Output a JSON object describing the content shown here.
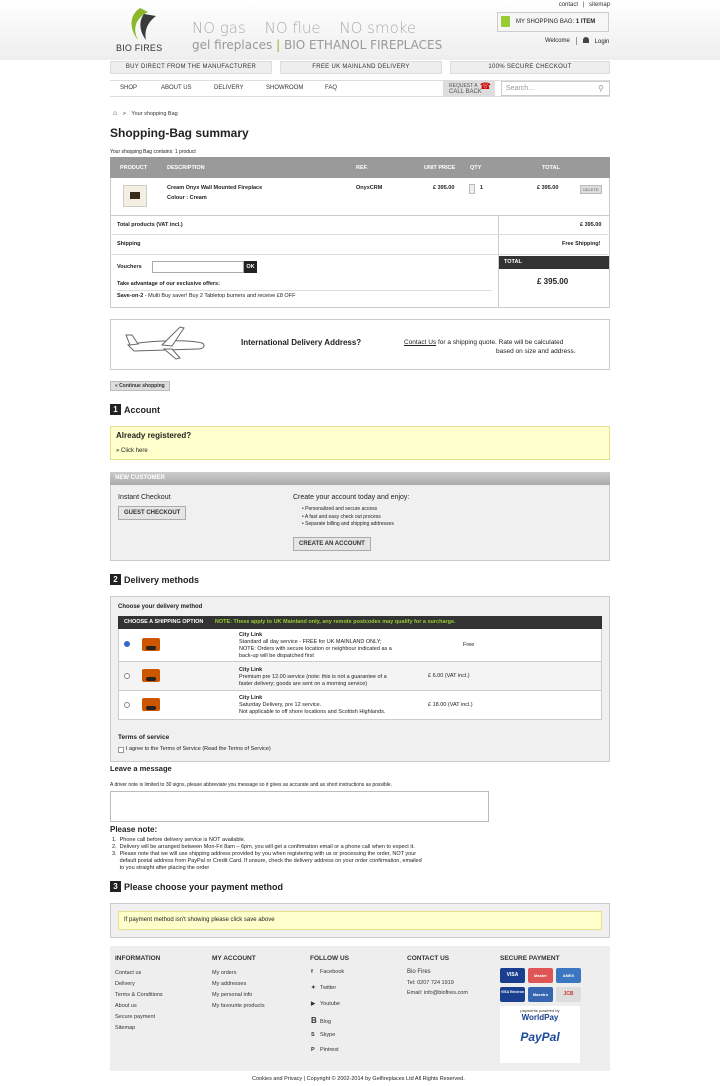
{
  "top_links": {
    "contact": "contact",
    "sep": "|",
    "sitemap": "sitemap"
  },
  "brand": {
    "logo_text": "BIO FIRES",
    "no_gas": "NO gas",
    "no_flue": "NO flue",
    "no_smoke": "NO smoke",
    "line2a": "gel fireplaces",
    "line2b": "BIO ETHANOL FIREPLACES"
  },
  "bag": {
    "label": "MY SHOPPING BAG:",
    "count": "1 ITEM"
  },
  "user": {
    "welcome": "Welcome",
    "login": "Login"
  },
  "promo_bars": [
    "BUY DIRECT FROM THE MANUFACTURER",
    "FREE UK MAINLAND DELIVERY",
    "100% SECURE CHECKOUT"
  ],
  "nav": [
    "SHOP",
    "ABOUT US",
    "DELIVERY",
    "SHOWROOM",
    "FAQ"
  ],
  "callback": {
    "l1": "REQUEST A",
    "l2": "CALL BACK"
  },
  "search": {
    "placeholder": "Search..."
  },
  "breadcrumb": {
    "sep": ">",
    "current": "Your shopping Bag"
  },
  "page_title": "Shopping-Bag summary",
  "contains": "Your shopping Bag contains: 1 product",
  "cart": {
    "headers": [
      "PRODUCT",
      "DESCRIPTION",
      "REF.",
      "UNIT PRICE",
      "QTY",
      "TOTAL"
    ],
    "item": {
      "name": "Cream Onyx Wall Mounted Fireplace",
      "colour": "Colour : Cream",
      "ref": "OnyxCRM",
      "unit": "£ 395.00",
      "qty": "1",
      "total": "£ 395.00",
      "delete": "DELETE"
    },
    "total_products_label": "Total products (VAT incl.)",
    "total_products": "£ 395.00",
    "shipping_label": "Shipping",
    "shipping": "Free Shipping!",
    "vouchers_label": "Vouchers",
    "ok": "OK",
    "offers_label": "Take advantage of our exclusive offers:",
    "offer_name": "Save-on-2",
    "offer_text": " - Multi Buy saver! Buy 2 Tabletop burners and receive £8 OFF",
    "total_label": "TOTAL",
    "total": "£ 395.00"
  },
  "intl": {
    "title": "International Delivery Address?",
    "link": "Contact Us",
    "text": " for a shipping quote. Rate will be calculated",
    "text2": "based on size and address."
  },
  "continue": "« Continue shopping",
  "account": {
    "num": "1",
    "title": "Account",
    "already": "Already registered?",
    "click": "» Click here",
    "new_customer": "NEW CUSTOMER",
    "instant": "Instant Checkout",
    "guest": "GUEST CHECKOUT",
    "create_text": "Create your account today and enjoy:",
    "benefits": [
      "Personalized and secure access",
      "A fast and easy check out process",
      "Separate billing and shipping addresses"
    ],
    "create_btn": "CREATE AN ACCOUNT"
  },
  "delivery": {
    "num": "2",
    "title": "Delivery methods",
    "choose": "Choose your delivery method",
    "hdr_label": "CHOOSE A SHIPPING OPTION",
    "hdr_note": "NOTE: These apply to UK Mainland only, any remote postcodes may qualify for a surcharge.",
    "options": [
      {
        "name": "City Link",
        "l1": "Standard all day service - FREE for UK MAINLAND ONLY;",
        "l2": "NOTE: Orders with secure location or neighbour indicated as a",
        "l3": "back-up will be dispatched first",
        "price": "Free"
      },
      {
        "name": "City Link",
        "l1": "Premium pre 12.00 service (note: this is not a guarantee of a",
        "l2": "faster delivery; goods are sent on a morning service)",
        "l3": "",
        "price": "£ 6.00 (VAT incl.)"
      },
      {
        "name": "City Link",
        "l1": "Saturday Delivery, pre 12 service.",
        "l2": "Not applicable to off shore locations and Scottish Highlands.",
        "l3": "",
        "price": "£ 18.00 (VAT incl.)"
      }
    ],
    "terms_title": "Terms of service",
    "terms_text": "I agree to the Terms of Service (Read the Terms of Service)"
  },
  "message": {
    "title": "Leave a message",
    "hint": "A driver note is limited to 30 signs, please abbreviate you message so it gives as accurate and as short instructions as possible."
  },
  "note": {
    "title": "Please note:",
    "items": [
      "1.  Phone call before delivery service is NOT available.",
      "2.  Delivery will be arranged between Mon-Fri 8am – 6pm, you will get a confirmation email or a phone call when to expect it.",
      "3.  Please note that we will use shipping address provided by you when registering with us or processing the order, NOT your",
      "     default postal address from PayPal or Credit Card. If unsure, check the delivery address on your order confirmation, emailed",
      "     to you straight after placing the order"
    ]
  },
  "payment": {
    "num": "3",
    "title": "Please choose your payment method",
    "warn": "If payment method isn't showing please click save above"
  },
  "footer": {
    "info_title": "INFORMATION",
    "info": [
      "Contact us",
      "Delivery",
      "Terms & Conditions",
      "About us",
      "Secure payment",
      "Sitemap"
    ],
    "acct_title": "MY ACCOUNT",
    "acct": [
      "My orders",
      "My addresses",
      "My personal info",
      "My favourite products"
    ],
    "follow_title": "FOLLOW US",
    "follow": [
      "Facebook",
      "Twitter",
      "Youtube",
      "Blog",
      "Skype",
      "Pintrest"
    ],
    "contact_title": "CONTACT US",
    "company": "Bio Fires",
    "tel": "Tel: 0207 724 1919",
    "email": "Email: info@biofires.com",
    "secure_title": "SECURE PAYMENT",
    "cards": [
      "VISA",
      "Master",
      "AMEX",
      "VISA Electron",
      "Maestro",
      "JCB"
    ],
    "worldpay1": "payments powered by",
    "worldpay2": "WorldPay",
    "paypal": "PayPal",
    "copyright": "Cookies and Privacy | Copyright © 2002-2014 by Gelfireplaces Ltd All Rights Reserved."
  }
}
